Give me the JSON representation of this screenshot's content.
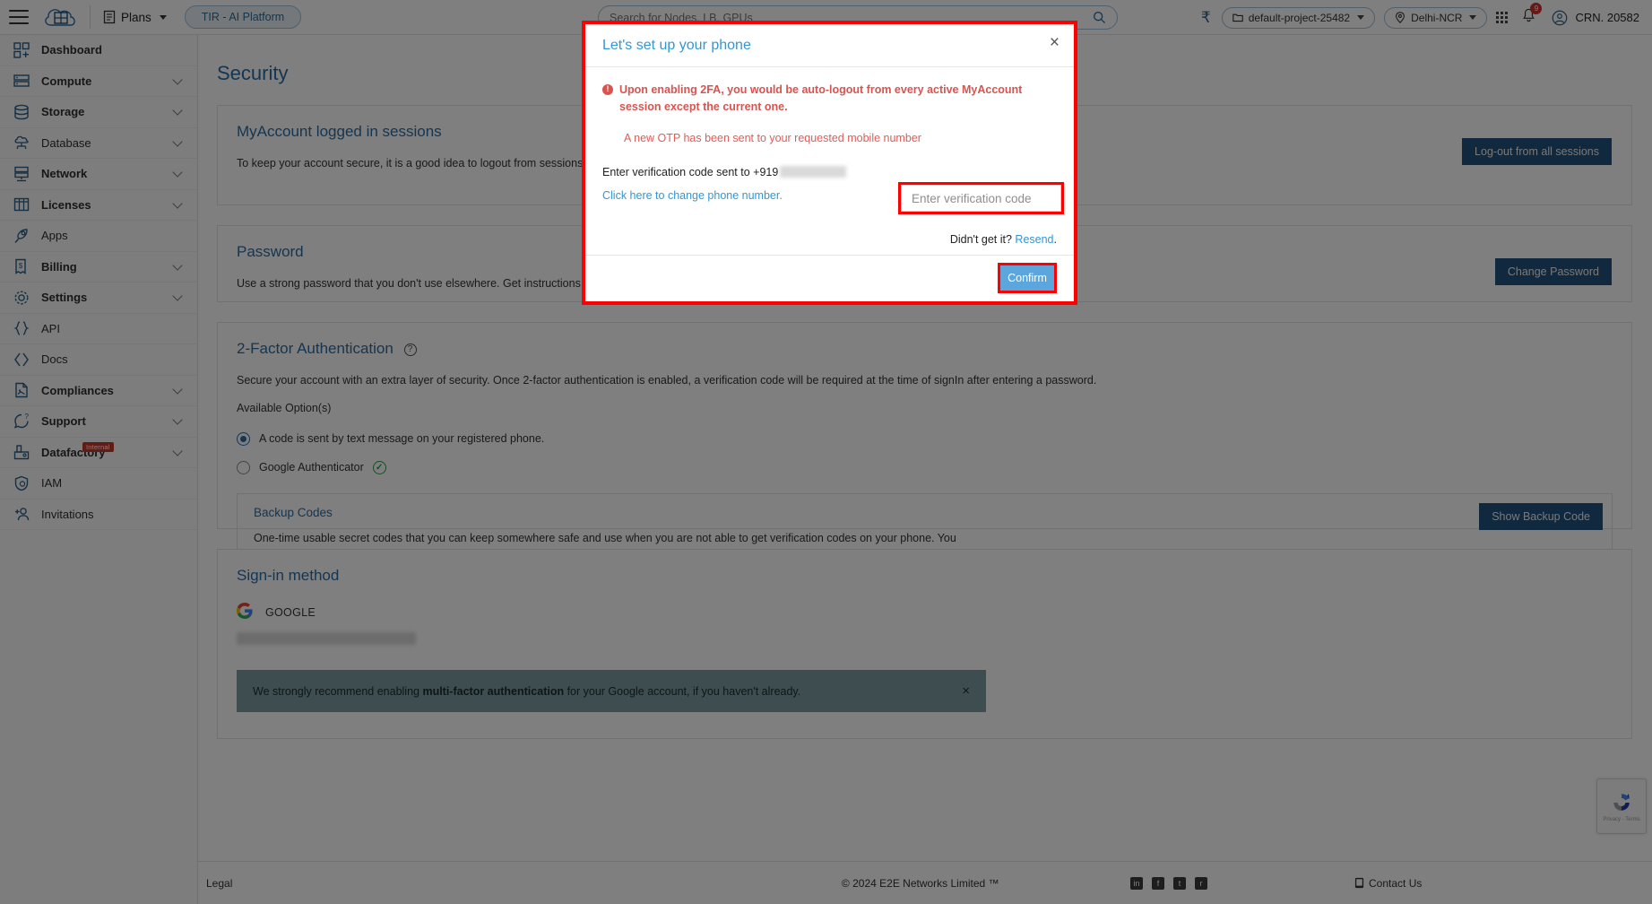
{
  "header": {
    "menu_icon": "hamburger-icon",
    "logo_text": "E2E Cloud",
    "plans_label": "Plans",
    "tir_label": "TIR - AI Platform",
    "search_placeholder": "Search for Nodes, LB, GPUs",
    "currency_symbol": "₹",
    "project_label": "default-project-25482",
    "region_label": "Delhi-NCR",
    "notification_count": "9",
    "account_label": "CRN. 20582"
  },
  "sidebar": {
    "items": [
      {
        "label": "Dashboard",
        "icon": "dashboard-icon",
        "expandable": false,
        "bold": true
      },
      {
        "label": "Compute",
        "icon": "server-icon",
        "expandable": true,
        "bold": true
      },
      {
        "label": "Storage",
        "icon": "database-stack-icon",
        "expandable": true,
        "bold": true
      },
      {
        "label": "Database",
        "icon": "cloud-database-icon",
        "expandable": true,
        "bold": false
      },
      {
        "label": "Network",
        "icon": "network-icon",
        "expandable": true,
        "bold": true
      },
      {
        "label": "Licenses",
        "icon": "licenses-grid-icon",
        "expandable": true,
        "bold": true
      },
      {
        "label": "Apps",
        "icon": "rocket-icon",
        "expandable": false,
        "bold": false
      },
      {
        "label": "Billing",
        "icon": "invoice-icon",
        "expandable": true,
        "bold": true
      },
      {
        "label": "Settings",
        "icon": "gear-icon",
        "expandable": true,
        "bold": true
      },
      {
        "label": "API",
        "icon": "braces-icon",
        "expandable": false,
        "bold": false
      },
      {
        "label": "Docs",
        "icon": "code-brackets-icon",
        "expandable": false,
        "bold": false
      },
      {
        "label": "Compliances",
        "icon": "document-icon",
        "expandable": true,
        "bold": true
      },
      {
        "label": "Support",
        "icon": "support-chat-icon",
        "expandable": true,
        "bold": true
      },
      {
        "label": "Datafactory",
        "icon": "datafactory-icon",
        "expandable": true,
        "bold": true,
        "tag": "Internal"
      },
      {
        "label": "IAM",
        "icon": "shield-user-icon",
        "expandable": false,
        "bold": false
      },
      {
        "label": "Invitations",
        "icon": "add-user-icon",
        "expandable": false,
        "bold": false
      }
    ]
  },
  "main": {
    "page_title": "Security",
    "sessions": {
      "title": "MyAccount logged in sessions",
      "body": "To keep your account secure, it is a good idea to logout from sessions you no longer use.",
      "button": "Log-out from all sessions"
    },
    "password": {
      "title": "Password",
      "body": "Use a strong password that you don't use elsewhere. Get instructions on creating a strong password.",
      "button": "Change Password"
    },
    "twofa": {
      "title": "2-Factor Authentication",
      "help_icon": "question-mark-icon",
      "body": "Secure your account with an extra layer of security. Once 2-factor authentication is enabled, a verification code will be required at the time of signIn after entering a password.",
      "options_label": "Available Option(s)",
      "options": [
        {
          "label": "A code is sent by text message on your registered phone.",
          "selected": true,
          "verified": false
        },
        {
          "label": "Google Authenticator",
          "selected": false,
          "verified": true
        }
      ],
      "backup": {
        "title": "Backup Codes",
        "body": "One-time usable secret codes that you can keep somewhere safe and use when you are not able to get verification codes on your phone. You can re-generate new codes anytime.",
        "button": "Show Backup Code"
      }
    },
    "signin": {
      "title": "Sign-in method",
      "provider": "GOOGLE",
      "provider_icon": "google-icon",
      "email_redacted": true,
      "notice_prefix": "We strongly recommend enabling ",
      "notice_bold": "multi-factor authentication",
      "notice_suffix": " for your Google account, if you haven't already.",
      "notice_close": "×"
    }
  },
  "modal": {
    "title": "Let's set up your phone",
    "close_label": "×",
    "warning": "Upon enabling 2FA, you would be auto-logout from every active MyAccount session except the current one.",
    "otp_note": "A new OTP has been sent to your requested mobile number",
    "enter_label": "Enter verification code sent to +919",
    "change_link": "Click here to change phone number.",
    "code_placeholder": "Enter verification code",
    "code_value": "",
    "resend_prefix": "Didn't get it? ",
    "resend_link": "Resend",
    "resend_suffix": ".",
    "confirm_label": "Confirm",
    "highlight_color": "#ff0000"
  },
  "footer": {
    "legal": "Legal",
    "copyright": "© 2024 E2E Networks Limited ™",
    "socials": [
      "in",
      "f",
      "t",
      "r"
    ],
    "contact": "Contact Us"
  },
  "recaptcha": {
    "privacy": "Privacy",
    "sep": "-",
    "terms": "Terms"
  }
}
